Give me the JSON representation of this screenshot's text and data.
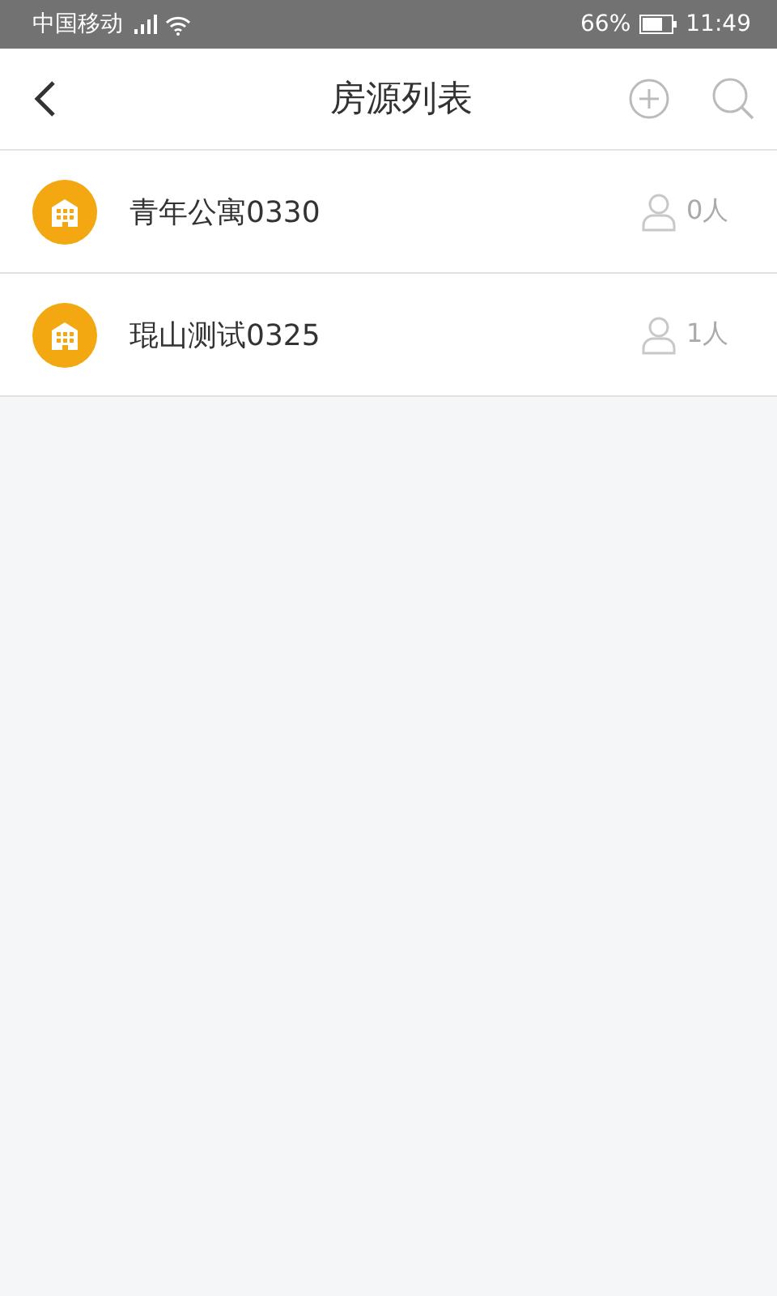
{
  "status_bar": {
    "carrier": "中国移动",
    "battery": "66%",
    "time": "11:49"
  },
  "header": {
    "title": "房源列表"
  },
  "properties": [
    {
      "name": "青年公寓0330",
      "occupants": "0人"
    },
    {
      "name": "琨山测试0325",
      "occupants": "1人"
    }
  ]
}
